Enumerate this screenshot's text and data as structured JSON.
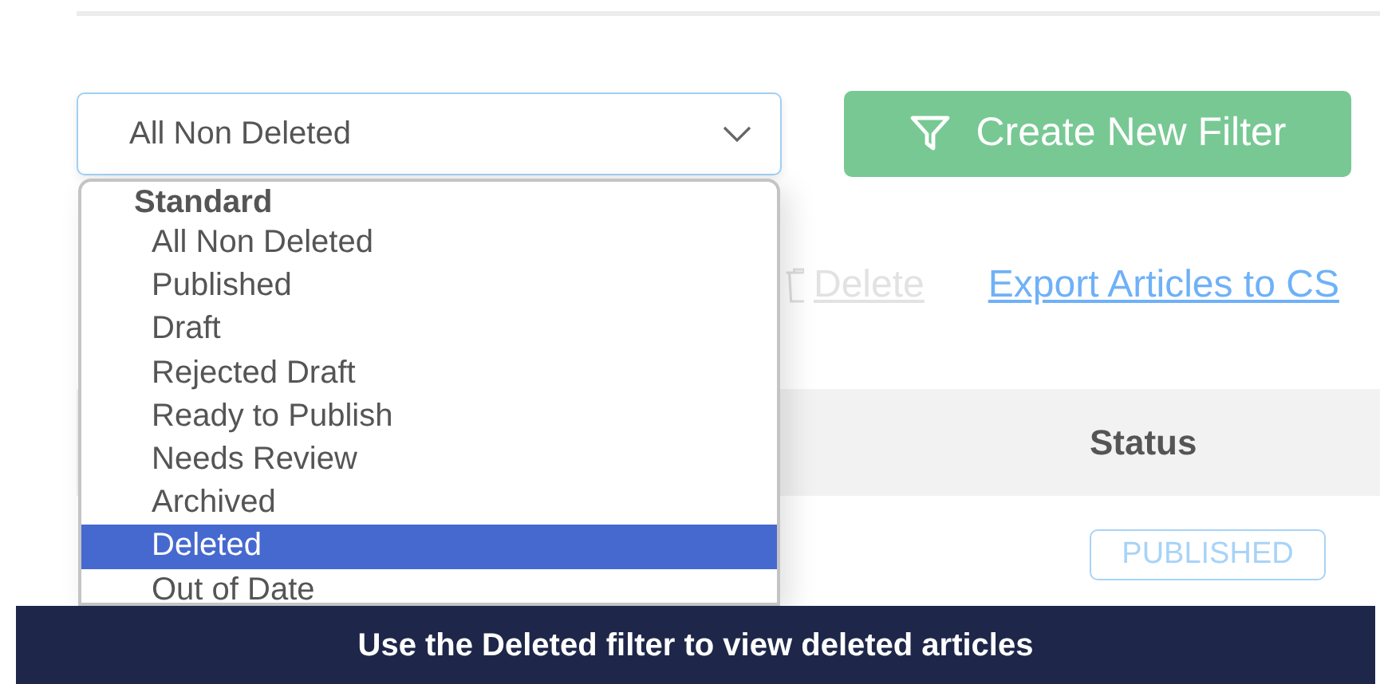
{
  "filter_select": {
    "value": "All Non Deleted"
  },
  "create_filter_button": {
    "label": "Create New Filter"
  },
  "dropdown": {
    "group_label": "Standard",
    "options": [
      {
        "label": "All Non Deleted",
        "selected": false
      },
      {
        "label": "Published",
        "selected": false
      },
      {
        "label": "Draft",
        "selected": false
      },
      {
        "label": "Rejected Draft",
        "selected": false
      },
      {
        "label": "Ready to Publish",
        "selected": false
      },
      {
        "label": "Needs Review",
        "selected": false
      },
      {
        "label": "Archived",
        "selected": false
      },
      {
        "label": "Deleted",
        "selected": true
      },
      {
        "label": "Out of Date",
        "selected": false
      }
    ]
  },
  "delete_link": {
    "label": "Delete",
    "disabled": true
  },
  "export_link": {
    "label": "Export Articles to CS"
  },
  "table": {
    "columns": [
      {
        "label": "Status"
      }
    ],
    "rows": [
      {
        "status": "PUBLISHED"
      }
    ]
  },
  "caption": "Use the Deleted filter to view deleted articles"
}
